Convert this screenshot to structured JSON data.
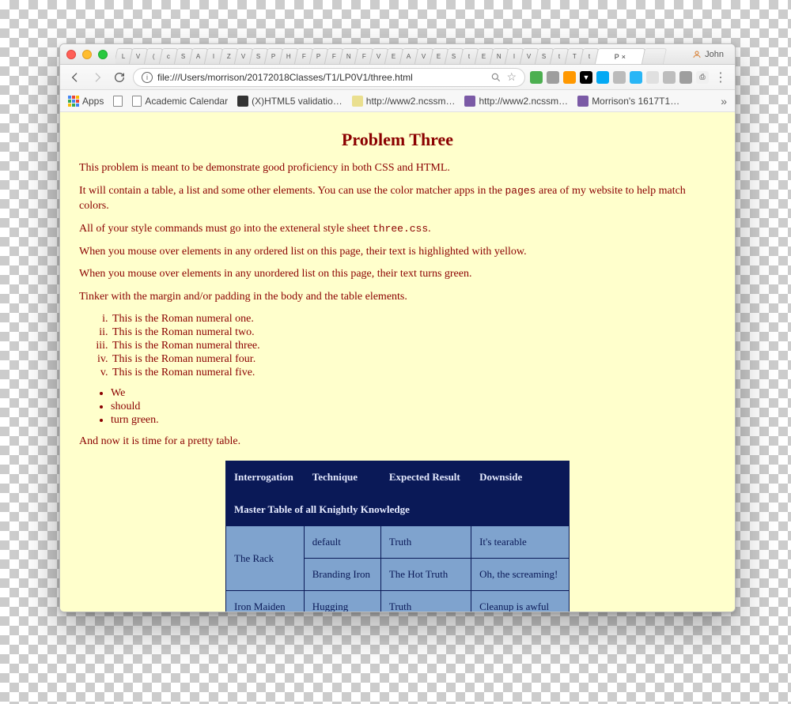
{
  "window": {
    "user_label": "John",
    "mini_tabs": [
      "L",
      "V",
      "(",
      "c",
      "S",
      "A",
      "I",
      "Z",
      "V",
      "S",
      "P",
      "H",
      "F",
      "P",
      "F",
      "N",
      "F",
      "V",
      "E",
      "A",
      "V",
      "E",
      "S",
      "t",
      "E",
      "N",
      "I",
      "V",
      "S",
      "t",
      "T",
      "t"
    ],
    "active_tab_label": "P",
    "url": "file:///Users/morrison/20172018Classes/T1/LP0V1/three.html"
  },
  "bookmarks": {
    "apps_label": "Apps",
    "items": [
      {
        "label": "Academic Calendar",
        "icon": "page"
      },
      {
        "label": "(X)HTML5 validatio…",
        "icon": "w3c"
      },
      {
        "label": "http://www2.ncssm…",
        "icon": "ncssm"
      },
      {
        "label": "http://www2.ncssm…",
        "icon": "ncssm"
      },
      {
        "label": "Morrison's 1617T1…",
        "icon": "ncssm"
      }
    ]
  },
  "page": {
    "title": "Problem Three",
    "paragraphs": {
      "p1": "This problem is meant to be demonstrate good proficiency in both CSS and HTML.",
      "p2a": "It will contain a table, a list and some other elements. You can use the color matcher apps in the ",
      "p2code": "pages",
      "p2b": " area of my website to help match colors.",
      "p3a": "All of your style commands must go into the exteneral style sheet ",
      "p3code": "three.css",
      "p3b": ".",
      "p4": "When you mouse over elements in any ordered list on this page, their text is highlighted with yellow.",
      "p5": "When you mouse over elements in any unordered list on this page, their text turns green.",
      "p6": "Tinker with the margin and/or padding in the body and the table elements.",
      "p7": "And now it is time for a pretty table."
    },
    "ol": [
      "This is the Roman numeral one.",
      "This is the Roman numeral two.",
      "This is the Roman numeral three.",
      "This is the Roman numeral four.",
      "This is the Roman numeral five."
    ],
    "ul": [
      "We",
      "should",
      "turn green."
    ],
    "table": {
      "caption": "Master Table of all Knightly Knowledge",
      "headers": [
        "Interrogation",
        "Technique",
        "Expected Result",
        "Downside"
      ],
      "rows": [
        {
          "interrogation": "The Rack",
          "technique": "default",
          "result": "Truth",
          "downside": "It's tearable",
          "rowspan_first": true
        },
        {
          "interrogation": "",
          "technique": "Branding Iron",
          "result": "The Hot Truth",
          "downside": "Oh, the screaming!",
          "rowspan_first": false
        },
        {
          "interrogation": "Iron Maiden",
          "technique": "Hugging",
          "result": "Truth",
          "downside": "Cleanup is awful",
          "rowspan_first": false
        }
      ]
    }
  }
}
